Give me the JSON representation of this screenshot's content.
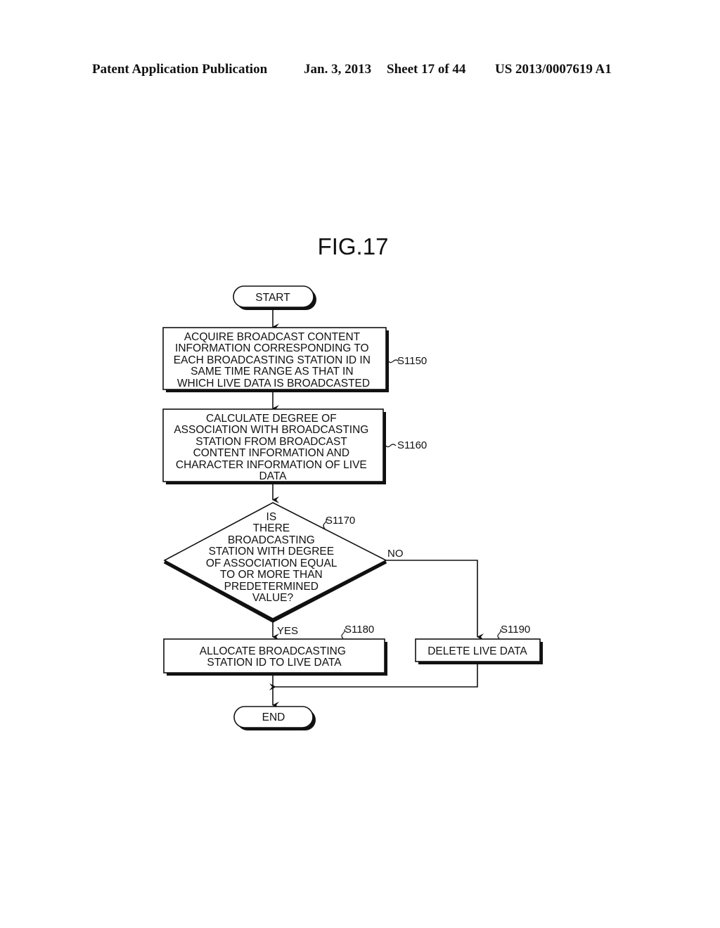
{
  "header": {
    "publication": "Patent Application Publication",
    "date": "Jan. 3, 2013",
    "sheet": "Sheet 17 of 44",
    "number": "US 2013/0007619 A1"
  },
  "figure": {
    "title": "FIG.17",
    "start": "START",
    "end": "END",
    "steps": [
      {
        "id": "S1150",
        "lines": [
          "ACQUIRE BROADCAST CONTENT",
          "INFORMATION CORRESPONDING TO",
          "EACH BROADCASTING STATION ID IN",
          "SAME TIME RANGE AS THAT IN",
          "WHICH LIVE DATA IS BROADCASTED"
        ]
      },
      {
        "id": "S1160",
        "lines": [
          "CALCULATE DEGREE OF",
          "ASSOCIATION WITH BROADCASTING",
          "STATION FROM BROADCAST",
          "CONTENT INFORMATION AND",
          "CHARACTER INFORMATION OF LIVE",
          "DATA"
        ]
      },
      {
        "id": "S1170",
        "lines": [
          "IS",
          "THERE",
          "BROADCASTING",
          "STATION WITH DEGREE",
          "OF ASSOCIATION EQUAL",
          "TO OR MORE THAN",
          "PREDETERMINED",
          "VALUE?"
        ]
      },
      {
        "id": "S1180",
        "lines": [
          "ALLOCATE BROADCASTING",
          "STATION ID TO LIVE DATA"
        ]
      },
      {
        "id": "S1190",
        "lines": [
          "DELETE LIVE DATA"
        ]
      }
    ],
    "branch_yes": "YES",
    "branch_no": "NO"
  }
}
